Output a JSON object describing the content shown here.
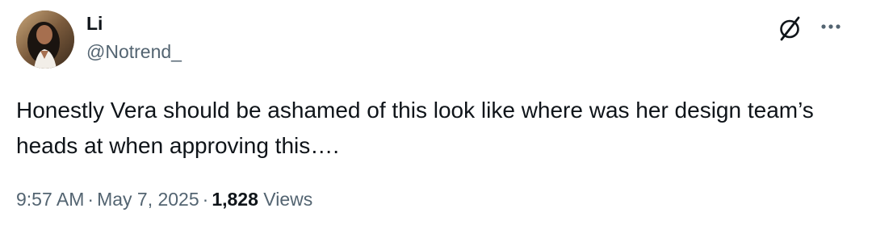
{
  "author": {
    "display_name": "Li",
    "handle": "@Notrend_",
    "avatar_icon": "profile-photo"
  },
  "actions": {
    "grok_icon": "grok-slash-circle-icon",
    "more_icon": "more-horizontal-icon"
  },
  "tweet": {
    "text": "Honestly Vera should be ashamed of this look like where was her design team’s heads at when approving this…."
  },
  "meta": {
    "time": "9:57 AM",
    "separator": "·",
    "date": "May 7, 2025",
    "views_count": "1,828",
    "views_label": "Views"
  },
  "colors": {
    "text_primary": "#0f1419",
    "text_secondary": "#536471",
    "background": "#ffffff"
  }
}
